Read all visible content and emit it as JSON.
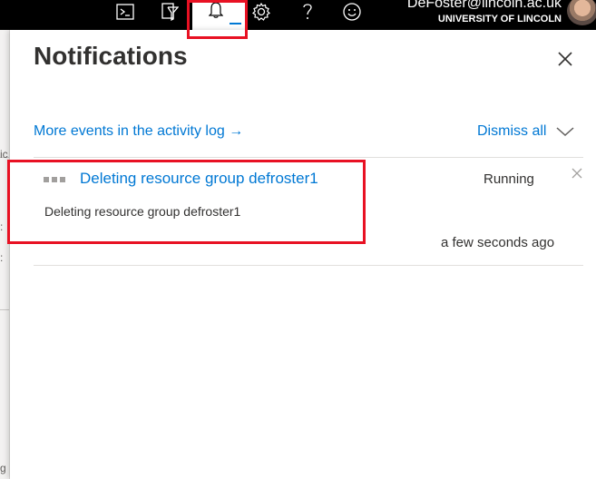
{
  "header": {
    "icons": [
      "cloud-shell-icon",
      "directory-filter-icon",
      "notifications-bell-icon",
      "settings-gear-icon",
      "help-icon",
      "feedback-smiley-icon"
    ],
    "active_icon": "notifications-bell-icon",
    "user_email": "DeFoster@lincoln.ac.uk",
    "user_org": "UNIVERSITY OF LINCOLN"
  },
  "notifications": {
    "title": "Notifications",
    "activity_log_link": "More events in the activity log →",
    "dismiss_all_label": "Dismiss all",
    "items": [
      {
        "title": "Deleting resource group defroster1",
        "status": "Running",
        "description": "Deleting resource group defroster1",
        "time": "a few seconds ago"
      }
    ]
  },
  "colors": {
    "accent": "#0078d4",
    "highlight": "#e81123",
    "topbar": "#000000"
  }
}
